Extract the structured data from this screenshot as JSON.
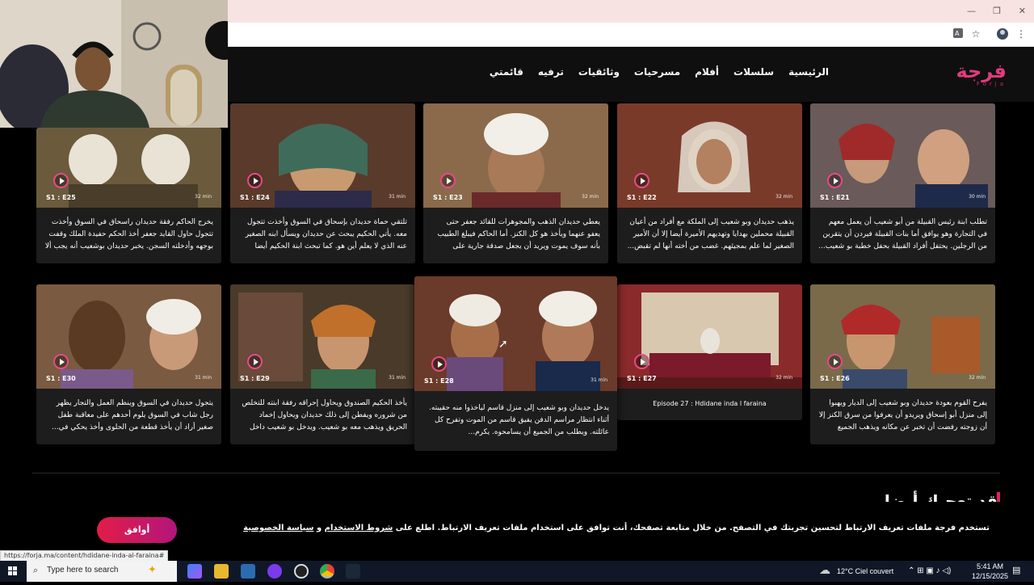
{
  "browser": {
    "window_controls": [
      "—",
      "❐",
      "✕"
    ],
    "icons": [
      "translate-icon",
      "star-icon",
      "profile-icon",
      "menu-icon"
    ]
  },
  "site": {
    "logo_arabic": "فرجة",
    "logo_latin": "Forja",
    "nav": [
      "الرئيسية",
      "سلسلات",
      "أفلام",
      "مسرحيات",
      "وثائقيات",
      "ترفيه",
      "قائمتي"
    ]
  },
  "episodes_row1": [
    {
      "badge": "S1 : E25",
      "duration": "32 min",
      "desc": "يخرج الحاكم رفقة حديدان راسحاق في السوق وأخذت تتجول حاول القايد جعفر أخذ الحكم حفيدة الملك وقفت بوجهه وأدخلته السجن. يخبر حديدان بوشعيب أنه يجب ألا يتحد..."
    },
    {
      "badge": "S1 : E24",
      "duration": "31 min",
      "desc": "تلتقي حماة حديدان بإسحاق في السوق وأخذت تتجول معه. يأتي الحكيم يبحث عن حديدان ويسأل ابنه الصغير عنه الذي لا يعلم أين هو. كما تبحث ابنة الحكيم أيضا عن..."
    },
    {
      "badge": "S1 : E23",
      "duration": "32 min",
      "desc": "يعطي حديدان الذهب والمجوهرات للقائد جعفر حتى يعفو عنهما ويأخذ هو كل الكنز. أما الحاكم فيبلغ الطبيب بأنه سوف يموت ويريد أن يجعل صدقة جارية على روحه..."
    },
    {
      "badge": "S1 : E22",
      "duration": "32 min",
      "desc": "يذهب حديدان وبو شعيب إلى الملكة مع أفراد من أعيان القبيلة محملين بهدايا وتهديهم الأميرة أيضا إلا أن الأمير الصغير لما علم بمجيئهم. غضب من أخته أنها لم تقبض..."
    },
    {
      "badge": "S1 : E21",
      "duration": "30 min",
      "desc": "تطلب ابنة رئيس القبيلة من أبو شعيب أن يعمل معهم في التجارة وهو يوافق أما بنات القبيلة فيردن أن يتقربن من الرجلين. يحتفل أفراد القبيلة بحفل خطبة بو شعيب..."
    }
  ],
  "episodes_row2": [
    {
      "badge": "S1 : E30",
      "duration": "31 min",
      "desc": "يتجول حديدان في السوق وينظم العمل والتجار يظهر رجل شاب في السوق يلوم أحدهم على معاقبة طفل صغير أراد أن يأخذ قطعة من الحلوى وأخذ يحكي في..."
    },
    {
      "badge": "S1 : E29",
      "duration": "31 min",
      "desc": "يأخذ الحكيم الصندوق ويحاول إحراقه رفقة ابنته للتخلص من شروره ويفطن إلى ذلك حديدان ويحاول إخماد الحريق ويذهب معه بو شعيب. ويدخل بو شعيب داخل الصندو..."
    },
    {
      "badge": "S1 : E28",
      "duration": "31 min",
      "desc": "يدخل حديدان وبو شعيب إلى منزل قاسم لياخذوا منه حقيبته. أثناء انتظار مراسم الدفن يفيق قاسم من الموت وتفرح كل عائلته. ويطلب من الجميع أن يسامحوه. يكرم..."
    },
    {
      "badge": "S1 : E27",
      "duration": "32 min",
      "desc": "Episode 27 : Hdidane inda l faraina"
    },
    {
      "badge": "S1 : E26",
      "duration": "32 min",
      "desc": "يفرح القوم بعودة حديدان وبو شعيب إلى الديار ويهبوا إلى منزل أبو إسحاق ويريدو أن يعرفوا من سرق الكنز إلا أن زوجته رفضت أن تخبر عن مكانه ويذهب الجميع لانتظاره..."
    }
  ],
  "section_title_partial": "قد تعجبك أيضا",
  "cookie": {
    "text_before": "تستخدم فرجة ملفات تعريف الارتباط لتحسين تجربتك في التصفح. من خلال متابعة تصفحك، أنت توافق على استخدام ملفات تعريف الارتباط. اطلع على",
    "terms_link": "شروط الاستخدام",
    "and": "و",
    "privacy_link": "سياسة الخصوصية",
    "accept_label": "أوافق"
  },
  "status_url": "https://forja.ma/content/hdidane-inda-al-faraina#",
  "taskbar": {
    "search_placeholder": "Type here to search",
    "weather": "12°C  Ciel couvert",
    "time": "5:41 AM",
    "date": "12/15/2025"
  },
  "colors": {
    "brand": "#e03b7c",
    "accent_button_start": "#e11d48",
    "accent_button_end": "#b3157b",
    "page_bg": "#000000",
    "card_bg": "#1d1d1d"
  }
}
